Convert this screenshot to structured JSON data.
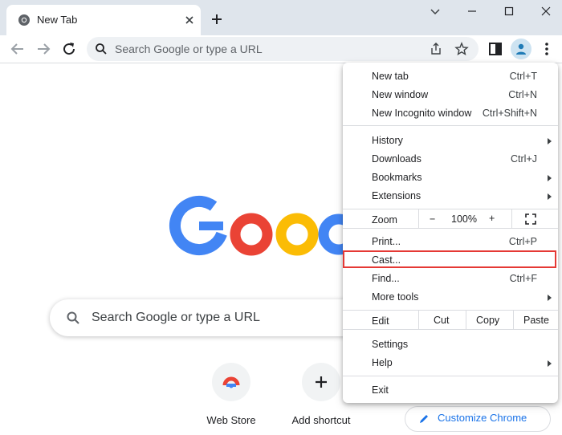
{
  "tab": {
    "title": "New Tab"
  },
  "omnibox": {
    "placeholder": "Search Google or type a URL"
  },
  "page": {
    "search_placeholder": "Search Google or type a URL",
    "shortcuts": [
      {
        "label": "Web Store"
      },
      {
        "label": "Add shortcut"
      }
    ],
    "customize_label": "Customize Chrome"
  },
  "menu": {
    "group1": [
      {
        "label": "New tab",
        "shortcut": "Ctrl+T"
      },
      {
        "label": "New window",
        "shortcut": "Ctrl+N"
      },
      {
        "label": "New Incognito window",
        "shortcut": "Ctrl+Shift+N"
      }
    ],
    "group2": [
      {
        "label": "History",
        "shortcut": ""
      },
      {
        "label": "Downloads",
        "shortcut": "Ctrl+J"
      },
      {
        "label": "Bookmarks",
        "shortcut": ""
      },
      {
        "label": "Extensions",
        "shortcut": ""
      }
    ],
    "zoom": {
      "label": "Zoom",
      "minus": "−",
      "value": "100%",
      "plus": "+"
    },
    "group3": [
      {
        "label": "Print...",
        "shortcut": "Ctrl+P"
      },
      {
        "label": "Cast...",
        "shortcut": ""
      },
      {
        "label": "Find...",
        "shortcut": "Ctrl+F"
      },
      {
        "label": "More tools",
        "shortcut": ""
      }
    ],
    "edit": {
      "label": "Edit",
      "cut": "Cut",
      "copy": "Copy",
      "paste": "Paste"
    },
    "group4": [
      {
        "label": "Settings"
      },
      {
        "label": "Help"
      }
    ],
    "exit": {
      "label": "Exit"
    }
  },
  "colors": {
    "google_blue": "#4285F4",
    "google_red": "#EA4335",
    "google_yellow": "#FBBC05",
    "google_green": "#34A853",
    "highlight": "#E53935",
    "accent": "#1A73E8"
  }
}
